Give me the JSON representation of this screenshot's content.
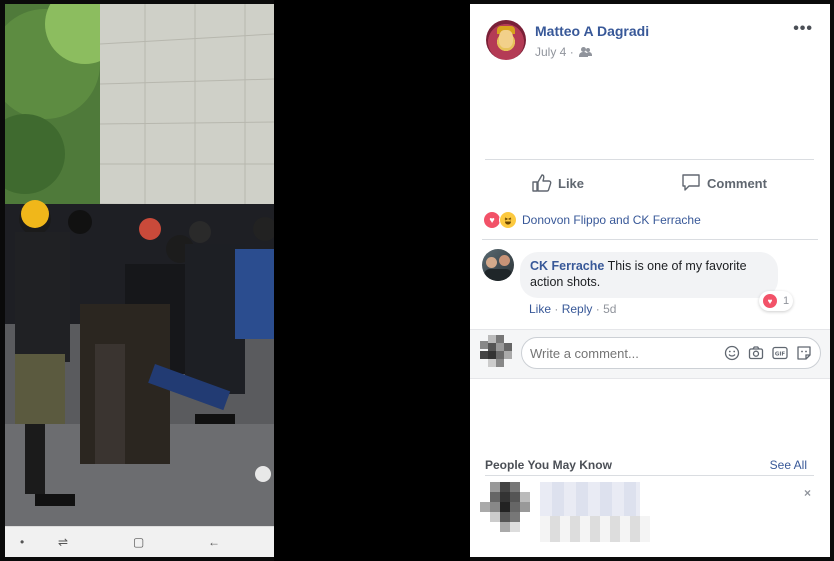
{
  "post": {
    "author": "Matteo A Dagradi",
    "date": "July 4",
    "separator": "·",
    "audience_icon": "friends-icon",
    "more_label": "•••"
  },
  "actions": {
    "like": "Like",
    "comment": "Comment"
  },
  "reactions": {
    "types": [
      "love",
      "haha"
    ],
    "names": "Donovon Flippo and CK Ferrache"
  },
  "comment": {
    "author": "CK Ferrache",
    "text": "This is one of my favorite action shots.",
    "reaction_count": "1",
    "like": "Like",
    "reply": "Reply",
    "age": "5d",
    "sep": "·"
  },
  "composer": {
    "placeholder": "Write a comment...",
    "icons": [
      "emoji-icon",
      "camera-icon",
      "gif-icon",
      "sticker-icon"
    ]
  },
  "people_you_may_know": {
    "title": "People You May Know",
    "see_all": "See All",
    "close": "×"
  },
  "phone_nav": {
    "dot": "•",
    "recents": "⇌",
    "home": "▢",
    "back": "←"
  },
  "colors": {
    "link": "#385898",
    "love": "#f25268",
    "haha": "#fcc93f"
  }
}
